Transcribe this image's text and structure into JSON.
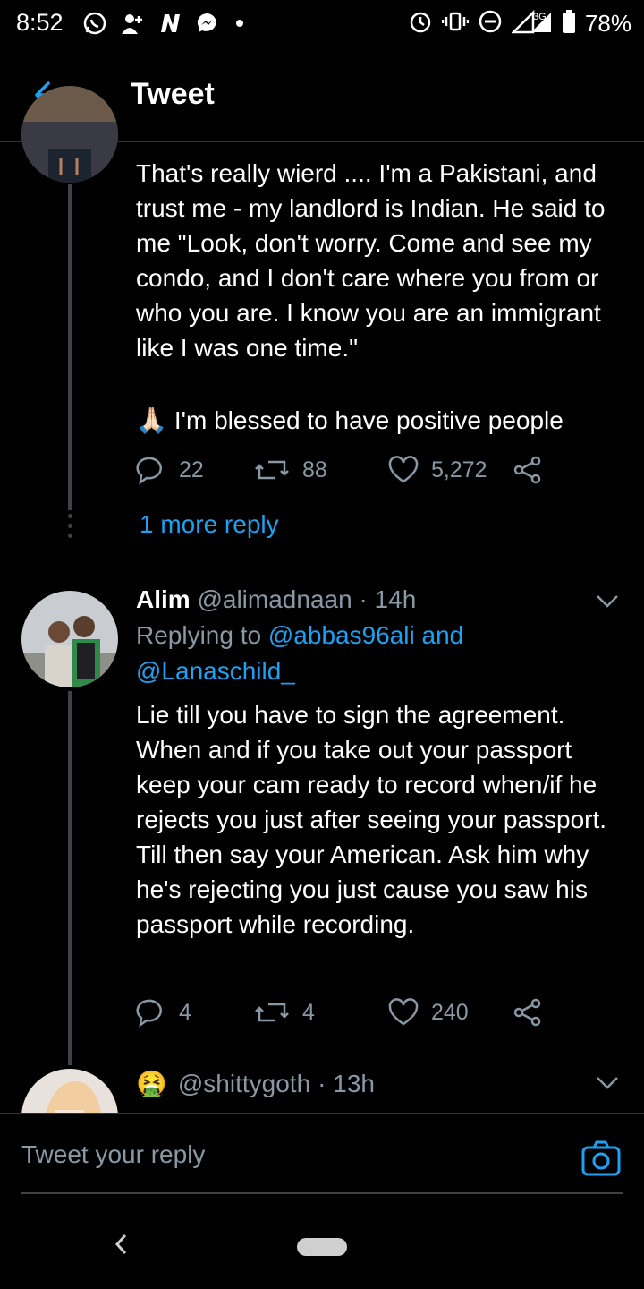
{
  "status_bar": {
    "time": "8:52",
    "network": "3G",
    "battery": "78%"
  },
  "header": {
    "title": "Tweet"
  },
  "tweet1": {
    "body": "That's really wierd .... I'm a Pakistani, and trust me - my landlord is Indian. He said to me \"Look, don't worry. Come and see my condo, and I don't care where you from or who you are. I know you are an immigrant like I was one time.\"",
    "body2": "I'm blessed to have positive people",
    "emoji": "🙏🏻",
    "replies": "22",
    "retweets": "88",
    "likes": "5,272"
  },
  "more_reply": "1 more reply",
  "tweet2": {
    "name": "Alim",
    "handle": "@alimadnaan",
    "time": "· 14h",
    "replying_to_label": "Replying to",
    "replying_to_1": "@abbas96ali and",
    "replying_to_2": "@Lanaschild_",
    "body": "Lie till you have to sign the agreement. When and if you take out your passport keep your cam ready to record when/if he rejects you just after seeing your passport. Till then say your American. Ask him why he's rejecting you just cause you saw his passport while recording.",
    "replies": "4",
    "retweets": "4",
    "likes": "240"
  },
  "tweet3": {
    "emoji": "🤮",
    "handle": "@shittygoth",
    "time": "· 13h"
  },
  "composer": {
    "placeholder": "Tweet your reply"
  },
  "colors": {
    "accent": "#1da1f2",
    "muted": "#8899a6",
    "background": "#000000"
  }
}
